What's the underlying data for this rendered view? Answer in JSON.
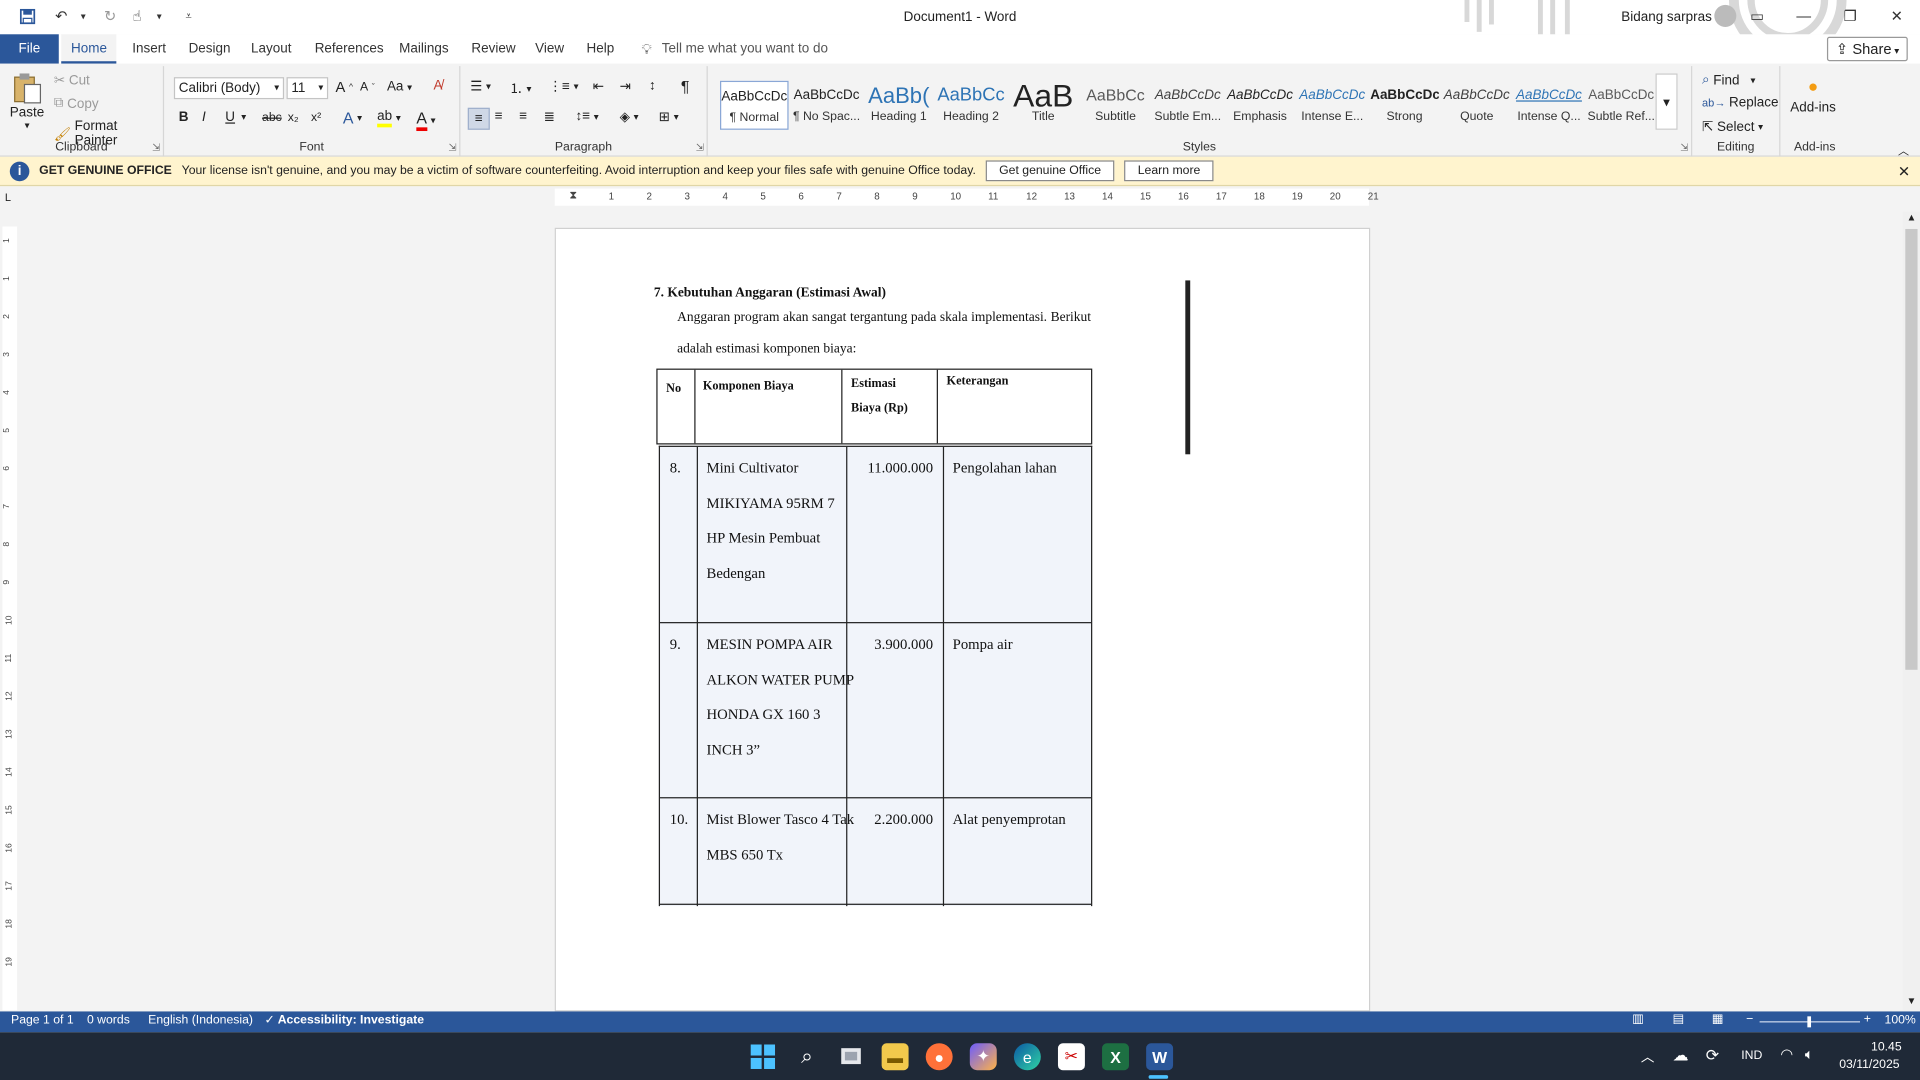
{
  "titlebar": {
    "doc_title": "Document1  -  Word",
    "user_name": "Bidang sarpras",
    "qat": [
      "save-icon",
      "undo-icon",
      "redo-icon",
      "touch-mode-icon",
      "customize-icon"
    ]
  },
  "tabs": [
    "File",
    "Home",
    "Insert",
    "Design",
    "Layout",
    "References",
    "Mailings",
    "Review",
    "View",
    "Help"
  ],
  "tell_me": "Tell me what you want to do",
  "share_label": "Share",
  "clipboard": {
    "paste": "Paste",
    "cut": "Cut",
    "copy": "Copy",
    "format_painter": "Format Painter",
    "label": "Clipboard"
  },
  "font": {
    "name": "Calibri (Body)",
    "size": "11",
    "label": "Font",
    "case": "Aa"
  },
  "paragraph": {
    "label": "Paragraph"
  },
  "styles": {
    "label": "Styles",
    "items": [
      {
        "preview": "AaBbCcDc",
        "label": "¶ Normal"
      },
      {
        "preview": "AaBbCcDc",
        "label": "¶ No Spac..."
      },
      {
        "preview": "AaBb(",
        "label": "Heading 1"
      },
      {
        "preview": "AaBbCc",
        "label": "Heading 2"
      },
      {
        "preview": "AaB",
        "label": "Title"
      },
      {
        "preview": "AaBbCc",
        "label": "Subtitle"
      },
      {
        "preview": "AaBbCcDc",
        "label": "Subtle Em..."
      },
      {
        "preview": "AaBbCcDc",
        "label": "Emphasis"
      },
      {
        "preview": "AaBbCcDc",
        "label": "Intense E..."
      },
      {
        "preview": "AaBbCcDc",
        "label": "Strong"
      },
      {
        "preview": "AaBbCcDc",
        "label": "Quote"
      },
      {
        "preview": "AaBbCcDc",
        "label": "Intense Q..."
      },
      {
        "preview": "AaBbCcDc",
        "label": "Subtle Ref..."
      }
    ]
  },
  "editing": {
    "find": "Find",
    "replace": "Replace",
    "select": "Select",
    "label": "Editing"
  },
  "addins": {
    "button": "Add-ins",
    "label": "Add-ins"
  },
  "infobar": {
    "title": "GET GENUINE OFFICE",
    "message": "Your license isn't genuine, and you may be a victim of software counterfeiting. Avoid interruption and keep your files safe with genuine Office today.",
    "btn_get": "Get genuine Office",
    "btn_learn": "Learn more"
  },
  "ruler_h": [
    "1",
    "2",
    "3",
    "4",
    "5",
    "6",
    "7",
    "8",
    "9",
    "10",
    "11",
    "12",
    "13",
    "14",
    "15",
    "16",
    "17",
    "18",
    "19",
    "20",
    "21"
  ],
  "ruler_v": [
    "1",
    "1",
    "2",
    "3",
    "4",
    "5",
    "6",
    "7",
    "8",
    "9",
    "10",
    "11",
    "12",
    "13",
    "14",
    "15",
    "16",
    "17",
    "18",
    "19"
  ],
  "document": {
    "heading": "7. Kebutuhan Anggaran (Estimasi Awal)",
    "para_line1": "Anggaran program akan sangat tergantung pada skala implementasi. Berikut",
    "para_line2": "adalah estimasi komponen biaya:",
    "table_header": {
      "no": "No",
      "komponen": "Komponen Biaya",
      "estimasi1": "Estimasi",
      "estimasi2": "Biaya (Rp)",
      "keterangan": "Keterangan"
    },
    "rows": [
      {
        "no": "8.",
        "komponen": [
          "Mini Cultivator",
          "MIKIYAMA 95RM 7",
          "HP Mesin Pembuat",
          "Bedengan"
        ],
        "biaya": "11.000.000",
        "ket": "Pengolahan lahan"
      },
      {
        "no": "9.",
        "komponen": [
          "MESIN POMPA AIR",
          "ALKON WATER PUMP",
          "HONDA GX 160 3",
          "INCH 3”"
        ],
        "biaya": "3.900.000",
        "ket": "Pompa air"
      },
      {
        "no": "10.",
        "komponen": [
          "Mist Blower Tasco 4 Tak",
          "MBS 650 Tx"
        ],
        "biaya": "2.200.000",
        "ket": "Alat penyemprotan"
      }
    ]
  },
  "status": {
    "page": "Page 1 of 1",
    "words": "0 words",
    "language": "English (Indonesia)",
    "accessibility": "Accessibility: Investigate",
    "zoom": "100%"
  },
  "tray": {
    "lang": "IND",
    "time": "10.45",
    "date": "03/11/2025"
  },
  "colors": {
    "accent": "#2b579a",
    "infobar": "#fff4ce",
    "taskbar": "#1f2937"
  }
}
